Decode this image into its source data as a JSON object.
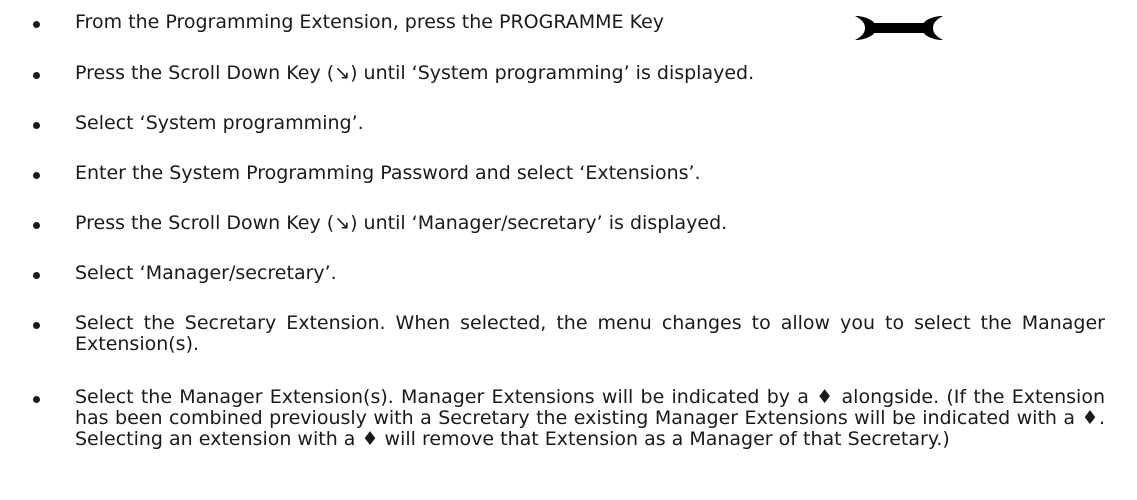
{
  "steps": [
    {
      "text": "From the Programming Extension, press the PROGRAMME Key"
    },
    {
      "text": "Press the Scroll Down Key (↘) until ‘System programming’ is displayed."
    },
    {
      "text": "Select ‘System programming’."
    },
    {
      "text": "Enter the System Programming Password and select ‘Extensions’."
    },
    {
      "text": "Press the Scroll Down Key (↘) until ‘Manager/secretary’ is displayed."
    },
    {
      "text": "Select ‘Manager/secretary’."
    },
    {
      "text": "Select the Secretary Extension.  When selected, the menu changes to allow you to select the Manager Extension(s)."
    },
    {
      "text": "Select the Manager Extension(s).  Manager Extensions will be indicated by a ♦ alongside.  (If the Extension has been combined previously with a Secretary the existing Manager Extensions will be indicated with a ♦.  Selecting an extension with a ♦ will remove that Extension as a Manager of that Secretary.)"
    }
  ],
  "icons": {
    "programme_key": "wrench-icon",
    "scroll_down_key": "scroll-down-arrow-icon",
    "manager_marker": "diamond-icon"
  }
}
